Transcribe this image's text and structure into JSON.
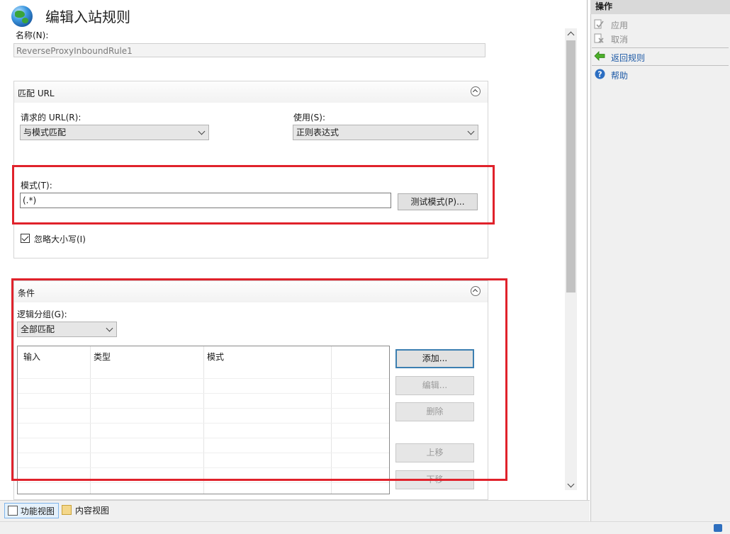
{
  "window": {
    "title": "编辑入站规则"
  },
  "rule": {
    "name_label": "名称(N):",
    "name_value": "ReverseProxyInboundRule1"
  },
  "match_url": {
    "title": "匹配 URL",
    "requested_url_label": "请求的 URL(R):",
    "requested_url_value": "与模式匹配",
    "using_label": "使用(S):",
    "using_value": "正则表达式",
    "pattern_label": "模式(T):",
    "pattern_value": "(.*)",
    "test_pattern_button": "测试模式(P)...",
    "ignore_case_label": "忽略大小写(I)",
    "ignore_case_checked": true
  },
  "conditions": {
    "title": "条件",
    "logical_grouping_label": "逻辑分组(G):",
    "logical_grouping_value": "全部匹配",
    "columns": [
      "输入",
      "类型",
      "模式"
    ],
    "buttons": {
      "add": "添加...",
      "edit": "编辑...",
      "remove": "删除",
      "move_up": "上移",
      "move_down": "下移"
    }
  },
  "bottom_tabs": {
    "features_view": "功能视图",
    "content_view": "内容视图"
  },
  "actions": {
    "header": "操作",
    "apply": "应用",
    "cancel": "取消",
    "back_to_rules": "返回规则",
    "help": "帮助"
  },
  "colors": {
    "highlight_box": "#e0222b",
    "link": "#1e5aa6",
    "primary_button_border": "#3c7fb1"
  }
}
